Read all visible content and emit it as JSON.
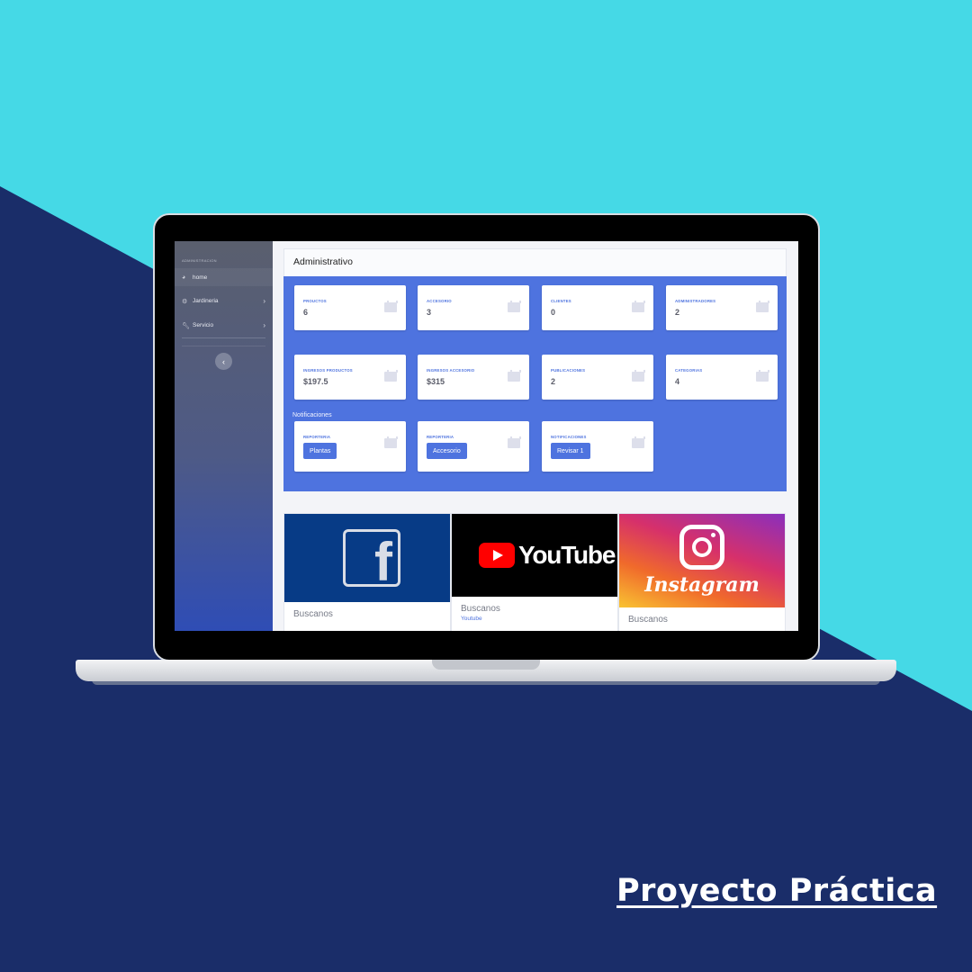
{
  "sidebar": {
    "heading": "ADMINISTRACION",
    "items": [
      {
        "label": "home",
        "icon": "dashboard-icon"
      },
      {
        "label": "Jardineria",
        "icon": "gear-icon"
      },
      {
        "label": "Servicio",
        "icon": "wrench-icon"
      }
    ],
    "collapse_label": "‹"
  },
  "panel": {
    "title": "Administrativo",
    "stats": [
      {
        "label": "PROUCTOS",
        "value": "6"
      },
      {
        "label": "ACCESORIO",
        "value": "3"
      },
      {
        "label": "CLIENTES",
        "value": "0"
      },
      {
        "label": "ADMINISTRADORES",
        "value": "2"
      },
      {
        "label": "INGRESOS PRODUCTOS",
        "value": "$197.5"
      },
      {
        "label": "INGRESOS ACCESORIO",
        "value": "$315"
      },
      {
        "label": "PUBLICACIONES",
        "value": "2"
      },
      {
        "label": "CATEGORIAS",
        "value": "4"
      }
    ],
    "notifications_label": "Notificaciones",
    "notifications": [
      {
        "label": "REPORTERIA",
        "button": "Plantas"
      },
      {
        "label": "REPORTERIA",
        "button": "Accesorio"
      },
      {
        "label": "NOTIFICACIONES",
        "button": "Revisar 1"
      }
    ]
  },
  "social": [
    {
      "name": "facebook",
      "logo_text": "f",
      "title": "Buscanos",
      "link": ""
    },
    {
      "name": "youtube",
      "logo_text": "YouTube",
      "title": "Buscanos",
      "link": "Youtube"
    },
    {
      "name": "instagram",
      "logo_text": "Instagram",
      "title": "Buscanos",
      "link": ""
    }
  ],
  "footer": {
    "title": "Proyecto Práctica"
  },
  "colors": {
    "background_dark": "#1a2d69",
    "background_cyan": "#45d9e6",
    "primary": "#4e73df"
  }
}
